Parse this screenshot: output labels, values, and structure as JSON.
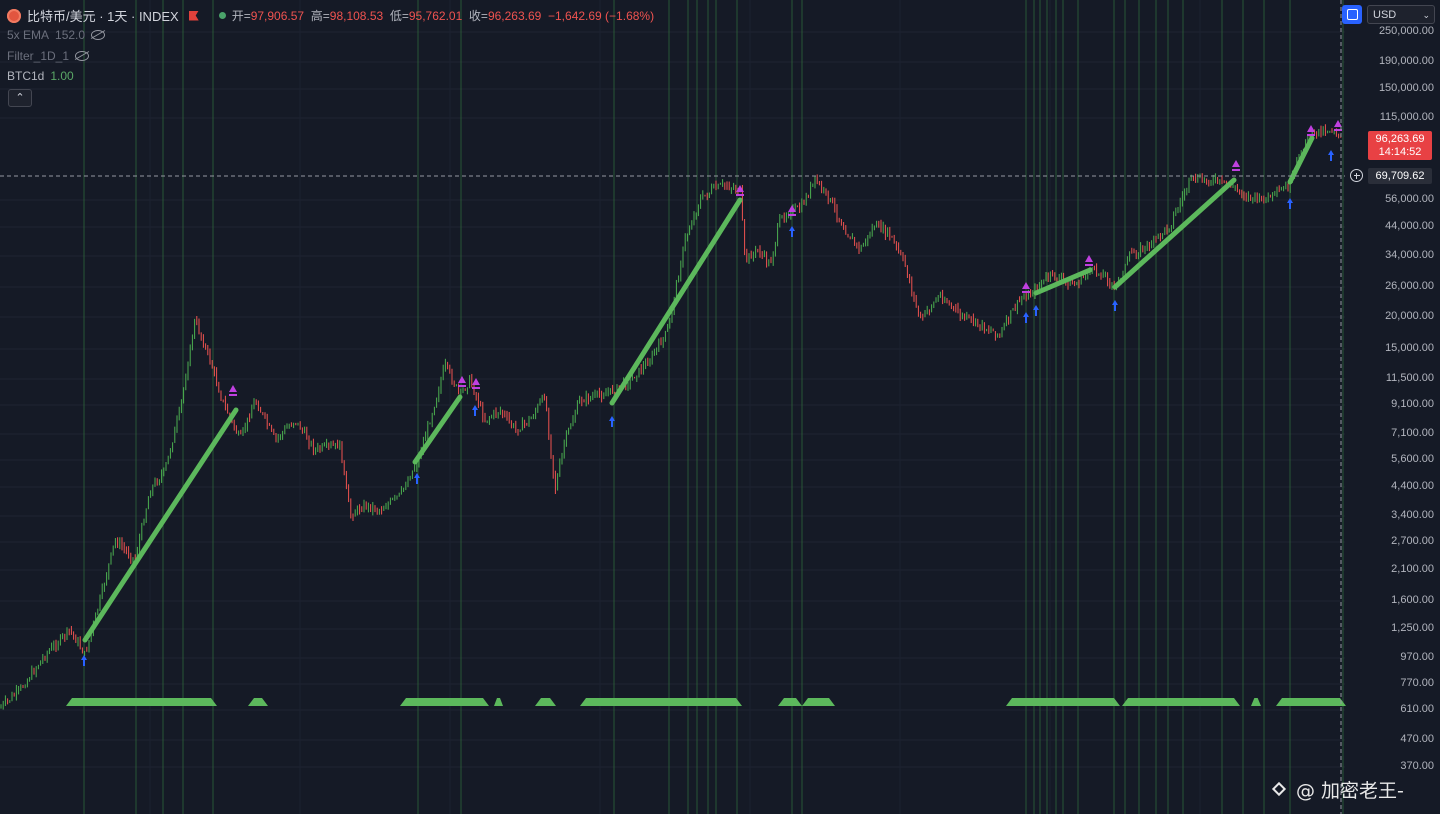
{
  "header": {
    "symbol_title": "比特币/美元 · 1天 · INDEX",
    "ohlc": {
      "open_label": "开=",
      "open": "97,906.57",
      "high_label": "高=",
      "high": "98,108.53",
      "low_label": "低=",
      "low": "95,762.01",
      "close_label": "收=",
      "close": "96,263.69",
      "change": "−1,642.69 (−1.68%)"
    }
  },
  "indicators": [
    {
      "name": "5x EMA",
      "value": "152.0"
    },
    {
      "name": "Filter_1D_1",
      "value": ""
    },
    {
      "name": "BTC1d",
      "value": "1.00"
    }
  ],
  "toolbar": {
    "currency": "USD"
  },
  "price_scale": {
    "labels": [
      "250,000.00",
      "190,000.00",
      "150,000.00",
      "115,000.00",
      "56,000.00",
      "44,000.00",
      "34,000.00",
      "26,000.00",
      "20,000.00",
      "15,000.00",
      "11,500.00",
      "9,100.00",
      "7,100.00",
      "5,600.00",
      "4,400.00",
      "3,400.00",
      "2,700.00",
      "2,100.00",
      "1,600.00",
      "1,250.00",
      "970.00",
      "770.00",
      "610.00",
      "470.00",
      "370.00"
    ],
    "last_price": "96,263.69",
    "countdown": "14:14:52",
    "crosshair_price": "69,709.62"
  },
  "colors": {
    "background": "#151a26",
    "up": "#4caf50",
    "down": "#ef5350",
    "trend_line": "#5cb85c",
    "buy_arrow": "#2962ff",
    "sell_marker": "#c040e0",
    "vline": "#2f6b3a"
  },
  "watermark": "@ 加密老王-"
}
